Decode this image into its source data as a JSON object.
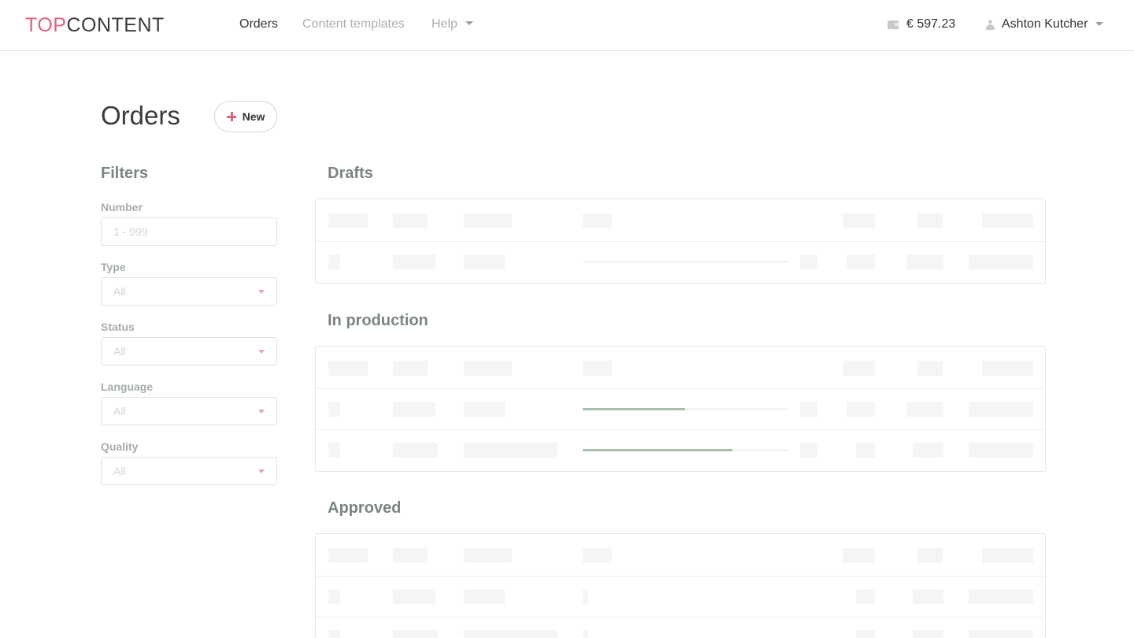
{
  "header": {
    "logo_part1": "TOP",
    "logo_part2": "CONTENT",
    "brand_color": "#e0627e",
    "nav": {
      "orders": "Orders",
      "templates": "Content templates",
      "help": "Help"
    },
    "balance": "€ 597.23",
    "user_name": "Ashton Kutcher"
  },
  "page": {
    "title": "Orders",
    "new_label": "New"
  },
  "filters": {
    "title": "Filters",
    "number": {
      "label": "Number",
      "placeholder": "1 - 999"
    },
    "type": {
      "label": "Type",
      "value": "All"
    },
    "status": {
      "label": "Status",
      "value": "All"
    },
    "language": {
      "label": "Language",
      "value": "All"
    },
    "quality": {
      "label": "Quality",
      "value": "All"
    }
  },
  "sections": {
    "drafts": "Drafts",
    "in_production": "In production",
    "approved": "Approved"
  },
  "progress": {
    "in_production_row1": 0.5,
    "in_production_row2": 0.73,
    "color": "#a9c0ad"
  }
}
